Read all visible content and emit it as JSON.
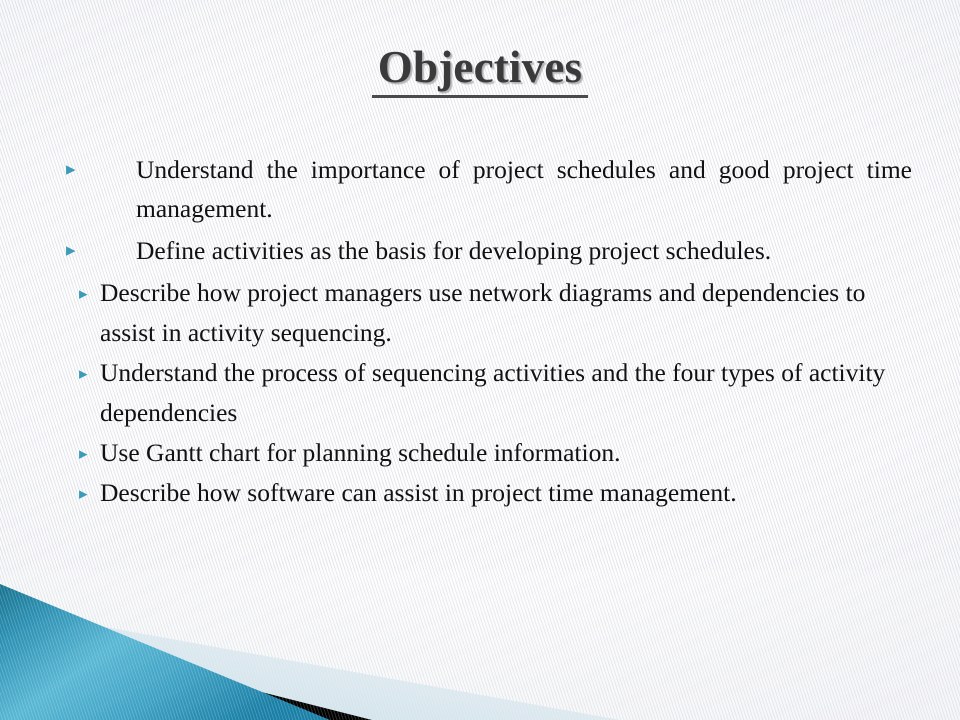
{
  "slide": {
    "title": "Objectives",
    "bullet_marker": "triangle-right-icon",
    "marker_glyph": "▸",
    "accent_color": "#3c9cb8",
    "text_color": "#111111",
    "title_color": "#3a3a3a",
    "background_color": "#fbfbfc"
  },
  "bullets": [
    {
      "text": "Understand the importance of project schedules and good project time management.",
      "style": "justified-wide-indent"
    },
    {
      "text": "Define activities as the basis for developing project schedules.",
      "style": "justified-wide-indent"
    },
    {
      "text": "Describe how project managers use network diagrams and dependencies to assist in activity sequencing.",
      "style": "left-tight-indent"
    },
    {
      "text": "Understand the process of sequencing activities and the four types of activity dependencies",
      "style": "left-tight-indent"
    },
    {
      "text": "Use Gantt chart for planning schedule information.",
      "style": "left-tight-indent"
    },
    {
      "text": "Describe how software can assist in project time management.",
      "style": "left-tight-indent"
    }
  ],
  "decoration": {
    "name": "bottom-diagonal-bands",
    "bands": [
      {
        "name": "teal-band",
        "color_start": "#1b7da0",
        "color_mid": "#54b4d2",
        "color_end": "#1d80a4"
      },
      {
        "name": "black-band",
        "color": "#000000"
      },
      {
        "name": "light-blue-band",
        "color_start": "#cfe2ea",
        "color_end": "#eef5f8"
      }
    ]
  }
}
